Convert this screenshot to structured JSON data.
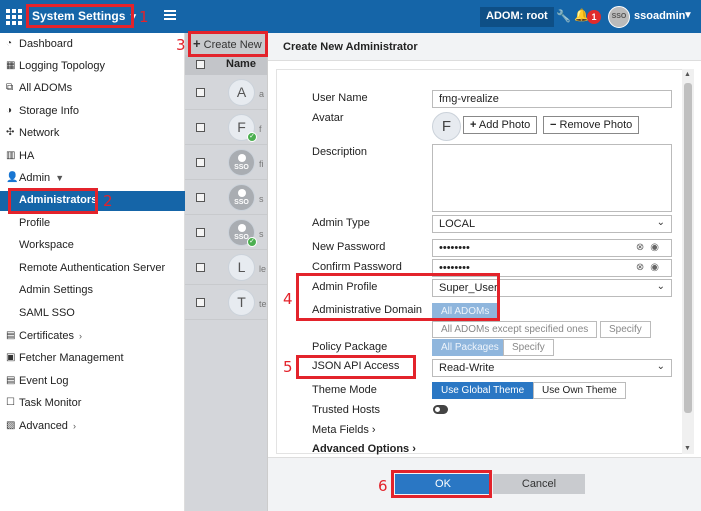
{
  "topbar": {
    "app_title": "System Settings",
    "adom": "ADOM: root",
    "notification_count": "1",
    "avatar_text": "SSO",
    "user_name": "ssoadmin"
  },
  "sidebar": {
    "items": [
      {
        "label": "Dashboard",
        "icon": "dashboard-icon"
      },
      {
        "label": "Logging Topology",
        "icon": "topology-icon"
      },
      {
        "label": "All ADOMs",
        "icon": "adoms-icon"
      },
      {
        "label": "Storage Info",
        "icon": "storage-icon"
      },
      {
        "label": "Network",
        "icon": "network-icon"
      },
      {
        "label": "HA",
        "icon": "ha-icon"
      },
      {
        "label": "Admin",
        "icon": "admin-icon"
      },
      {
        "label": "Administrators"
      },
      {
        "label": "Profile"
      },
      {
        "label": "Workspace"
      },
      {
        "label": "Remote Authentication Server"
      },
      {
        "label": "Admin Settings"
      },
      {
        "label": "SAML SSO"
      },
      {
        "label": "Certificates",
        "icon": "certificate-icon"
      },
      {
        "label": "Fetcher Management",
        "icon": "fetcher-icon"
      },
      {
        "label": "Event Log",
        "icon": "event-log-icon"
      },
      {
        "label": "Task Monitor",
        "icon": "task-icon"
      },
      {
        "label": "Advanced",
        "icon": "advanced-icon"
      }
    ]
  },
  "list": {
    "create_label": "Create New",
    "column_name": "Name",
    "rows": [
      {
        "avatar": "A",
        "tail": "a"
      },
      {
        "avatar": "F",
        "tail": "f"
      },
      {
        "avatar": "SSO",
        "tail": "fi"
      },
      {
        "avatar": "SSO",
        "tail": "s"
      },
      {
        "avatar": "SSO",
        "tail": "s"
      },
      {
        "avatar": "L",
        "tail": "le"
      },
      {
        "avatar": "T",
        "tail": "te"
      }
    ]
  },
  "dialog": {
    "title": "Create New Administrator",
    "user_name_label": "User Name",
    "user_name_value": "fmg-vrealize",
    "avatar_label": "Avatar",
    "avatar_letter": "F",
    "add_photo": "Add Photo",
    "remove_photo": "Remove Photo",
    "description_label": "Description",
    "admin_type_label": "Admin Type",
    "admin_type_value": "LOCAL",
    "new_password_label": "New Password",
    "new_password_value": "••••••••",
    "confirm_password_label": "Confirm Password",
    "confirm_password_value": "••••••••",
    "admin_profile_label": "Admin Profile",
    "admin_profile_value": "Super_User",
    "admin_domain_label": "Administrative Domain",
    "all_adoms": "All ADOMs",
    "all_adoms_except": "All ADOMs except specified ones",
    "specify_1": "Specify",
    "policy_package_label": "Policy Package",
    "all_packages": "All Packages",
    "specify_2": "Specify",
    "json_api_label": "JSON API Access",
    "json_api_value": "Read-Write",
    "theme_mode_label": "Theme Mode",
    "use_global_theme": "Use Global Theme",
    "use_own_theme": "Use Own Theme",
    "trusted_hosts_label": "Trusted Hosts",
    "meta_fields_label": "Meta Fields",
    "advanced_options_label": "Advanced Options",
    "ok": "OK",
    "cancel": "Cancel"
  },
  "annotations": [
    "1",
    "2",
    "3",
    "4",
    "5",
    "6"
  ],
  "colors": {
    "topbar": "#1565a8",
    "active_item": "#1565a8",
    "primary_button": "#2a77c4",
    "highlight": "#e3232b",
    "badge": "#e02b2b"
  }
}
